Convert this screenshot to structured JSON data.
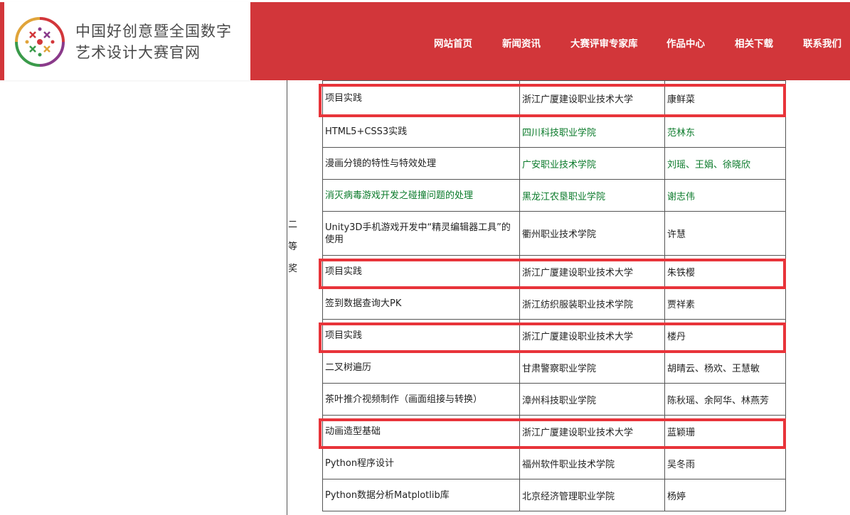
{
  "site": {
    "title_line1": "中国好创意暨全国数字",
    "title_line2": "艺术设计大赛官网",
    "colors": {
      "brand_red": "#d2363a",
      "highlight_red": "#e8343a",
      "link_green": "#0a7a2a"
    }
  },
  "nav": {
    "items": [
      {
        "label": "网站首页"
      },
      {
        "label": "新闻资讯"
      },
      {
        "label": "大赛评审专家库"
      },
      {
        "label": "作品中心"
      },
      {
        "label": "相关下载"
      },
      {
        "label": "联系我们"
      }
    ]
  },
  "award": {
    "chars": [
      "二",
      "等",
      "奖"
    ]
  },
  "rows": [
    {
      "course": "项目实践",
      "school": "浙江广厦建设职业技术大学",
      "author": "康鲜菜",
      "green": [
        false,
        false,
        false
      ],
      "highlight": true
    },
    {
      "course": "HTML5+CSS3实践",
      "school": "四川科技职业学院",
      "author": "范林东",
      "green": [
        false,
        true,
        true
      ],
      "highlight": false
    },
    {
      "course": "漫画分镜的特性与特效处理",
      "school": "广安职业技术学院",
      "author": "刘瑶、王娟、徐晓欣",
      "green": [
        false,
        true,
        true
      ],
      "highlight": false
    },
    {
      "course": "消灭病毒游戏开发之碰撞问题的处理",
      "school": "黑龙江农垦职业学院",
      "author": "谢志伟",
      "green": [
        true,
        true,
        true
      ],
      "highlight": false
    },
    {
      "course": "Unity3D手机游戏开发中“精灵编辑器工具”的使用",
      "school": "衢州职业技术学院",
      "author": "许慧",
      "green": [
        false,
        false,
        false
      ],
      "highlight": false
    },
    {
      "course": "项目实践",
      "school": "浙江广厦建设职业技术大学",
      "author": "朱铁樱",
      "green": [
        false,
        false,
        false
      ],
      "highlight": true
    },
    {
      "course": "签到数据查询大PK",
      "school": "浙江纺织服装职业技术学院",
      "author": "贾祥素",
      "green": [
        false,
        false,
        false
      ],
      "highlight": false
    },
    {
      "course": "项目实践",
      "school": "浙江广厦建设职业技术大学",
      "author": "楼丹",
      "green": [
        false,
        false,
        false
      ],
      "highlight": true
    },
    {
      "course": "二叉树遍历",
      "school": "甘肃警察职业学院",
      "author": "胡晴云、杨欢、王慧敏",
      "green": [
        false,
        false,
        false
      ],
      "highlight": false
    },
    {
      "course": "茶叶推介视频制作（画面组接与转换）",
      "school": "漳州科技职业学院",
      "author": "陈秋瑶、余阿华、林燕芳",
      "green": [
        false,
        false,
        false
      ],
      "highlight": false
    },
    {
      "course": "动画造型基础",
      "school": "浙江广厦建设职业技术大学",
      "author": "蓝颖珊",
      "green": [
        false,
        false,
        false
      ],
      "highlight": true
    },
    {
      "course": "Python程序设计",
      "school": "福州软件职业技术学院",
      "author": "吴冬雨",
      "green": [
        false,
        false,
        false
      ],
      "highlight": false
    },
    {
      "course": "Python数据分析Matplotlib库",
      "school": "北京经济管理职业学院",
      "author": "杨婷",
      "green": [
        false,
        false,
        false
      ],
      "highlight": false
    }
  ]
}
